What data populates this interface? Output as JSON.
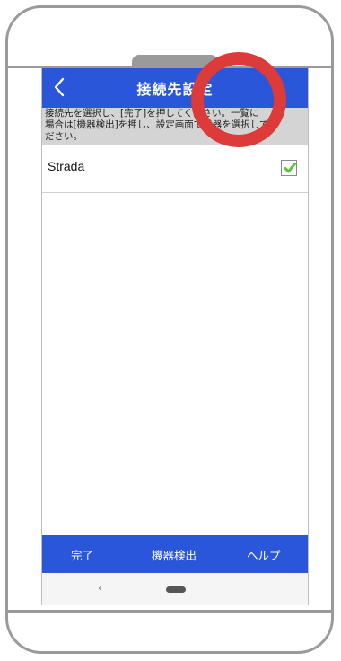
{
  "header": {
    "title": "接続先設定",
    "back_icon": "chevron-left-icon"
  },
  "notice": {
    "line1": "接続先を選択し、[完了]を押してください。一覧に",
    "line2": "場合は[機器検出]を押し、設定画面で機器を選択してく",
    "line3": "ださい。"
  },
  "devices": [
    {
      "name": "Strada",
      "checked": true
    }
  ],
  "bottom_bar": {
    "done_label": "完了",
    "detect_label": "機器検出",
    "help_label": "ヘルプ"
  },
  "nav": {
    "back_glyph": "‹"
  },
  "colors": {
    "accent": "#2a56d9",
    "notice_bg": "#d4d4d4",
    "check": "#5cc33a",
    "highlight_circle": "#dd3a3a"
  }
}
